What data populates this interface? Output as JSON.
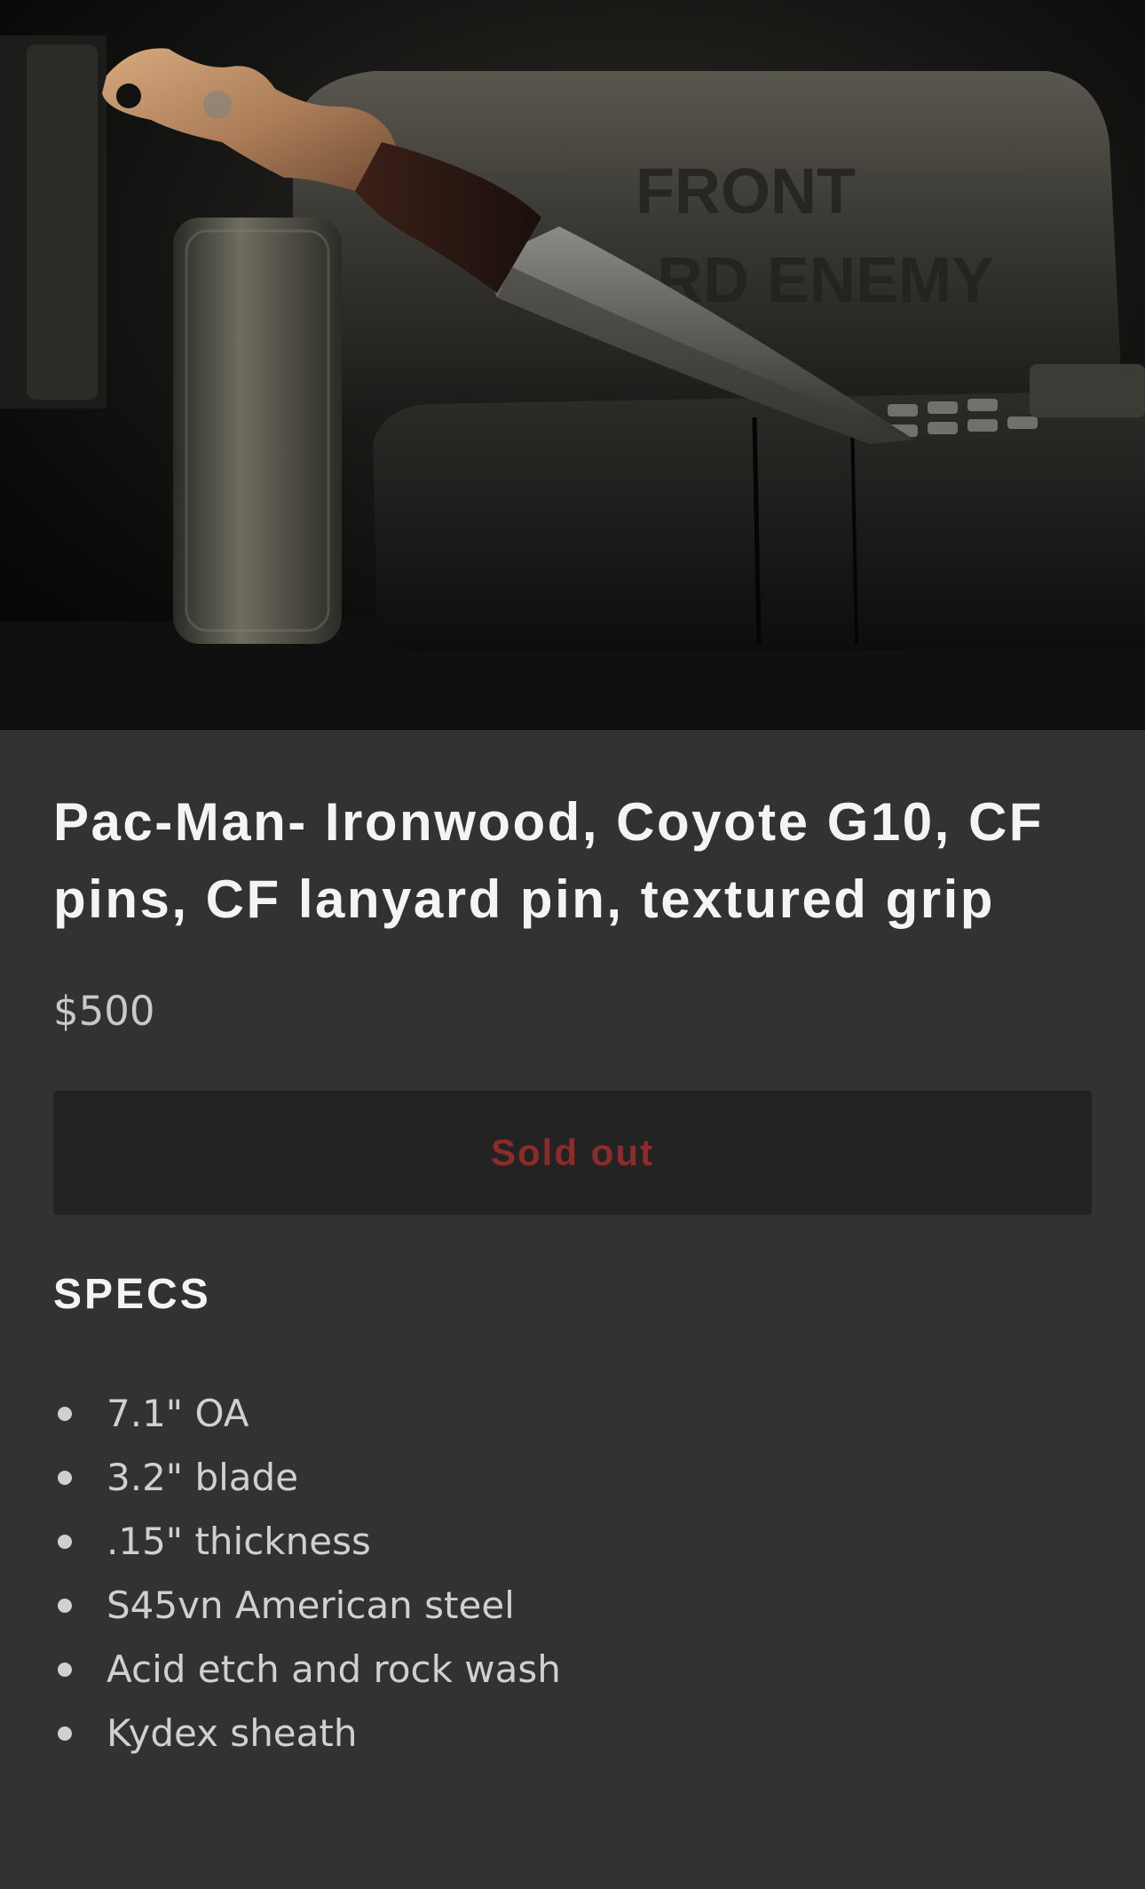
{
  "product": {
    "image_alt": "",
    "title": "Pac-Man- Ironwood, Coyote G10, CF pins, CF lanyard pin, textured grip",
    "price": "$500",
    "button_label": "Sold out",
    "colors": {
      "background": "#323232",
      "button_bg": "#232323",
      "button_text": "#8d2b2b",
      "title_text": "#f4f4f4"
    }
  },
  "hero_image": {
    "engraved_text_line1": "FRONT",
    "engraved_text_line2": "RD ENEMY"
  },
  "specs": {
    "heading": "SPECS",
    "items": [
      "7.1\" OA",
      "3.2\" blade",
      ".15\" thickness",
      "S45vn American steel",
      "Acid etch and rock wash",
      "Kydex sheath"
    ]
  }
}
